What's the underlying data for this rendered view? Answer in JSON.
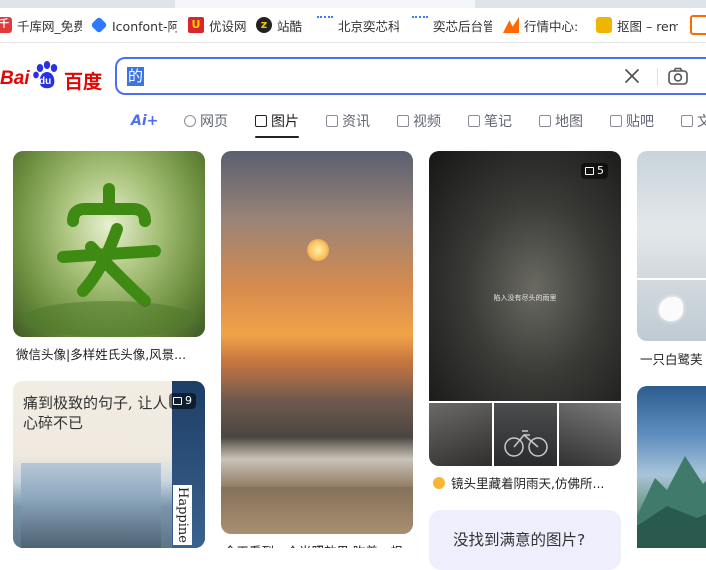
{
  "bookmarks": [
    {
      "label": "千库网_免费",
      "icon": "qianku-icon"
    },
    {
      "label": "Iconfont-阿",
      "icon": "iconfont-icon"
    },
    {
      "label": "优设网",
      "icon": "youshe-icon"
    },
    {
      "label": "站酷",
      "icon": "zcool-icon"
    },
    {
      "label": "北京奕芯科",
      "icon": "dots-icon"
    },
    {
      "label": "奕芯后台管",
      "icon": "dots-icon"
    },
    {
      "label": "行情中心:",
      "icon": "market-icon"
    },
    {
      "label": "抠图 – rem",
      "icon": "koutu-icon"
    }
  ],
  "header": {
    "logo_text_1": "Bai",
    "logo_text_paw": "du",
    "logo_text_2": "百度",
    "search_value": "的",
    "brand_color": "#4e6ef2"
  },
  "nav": {
    "ai_label": "Ai+",
    "tabs": [
      {
        "label": "网页",
        "icon": "search-icon"
      },
      {
        "label": "图片",
        "icon": "image-icon",
        "active": true
      },
      {
        "label": "资讯",
        "icon": "news-icon"
      },
      {
        "label": "视频",
        "icon": "video-icon"
      },
      {
        "label": "笔记",
        "icon": "note-icon"
      },
      {
        "label": "地图",
        "icon": "map-icon"
      },
      {
        "label": "贴吧",
        "icon": "tieba-icon"
      },
      {
        "label": "文",
        "icon": "doc-icon"
      }
    ]
  },
  "results": {
    "card1_caption": "微信头像|多样姓氏头像,风景...",
    "card2_caption": "今天看到一个光照效果,吹着一根",
    "card3_caption": "镜头里藏着阴雨天,仿佛所...",
    "card3_badge": "5",
    "card3_overlay_text": "陷入没有尽头的雨里",
    "card4_caption": "一只白鹭芙",
    "card5_badge": "9",
    "card5_quote": "痛到极致的句子, 让人心碎不已",
    "card5_vertical": "Happine",
    "not_found_text": "没找到满意的图片?"
  }
}
